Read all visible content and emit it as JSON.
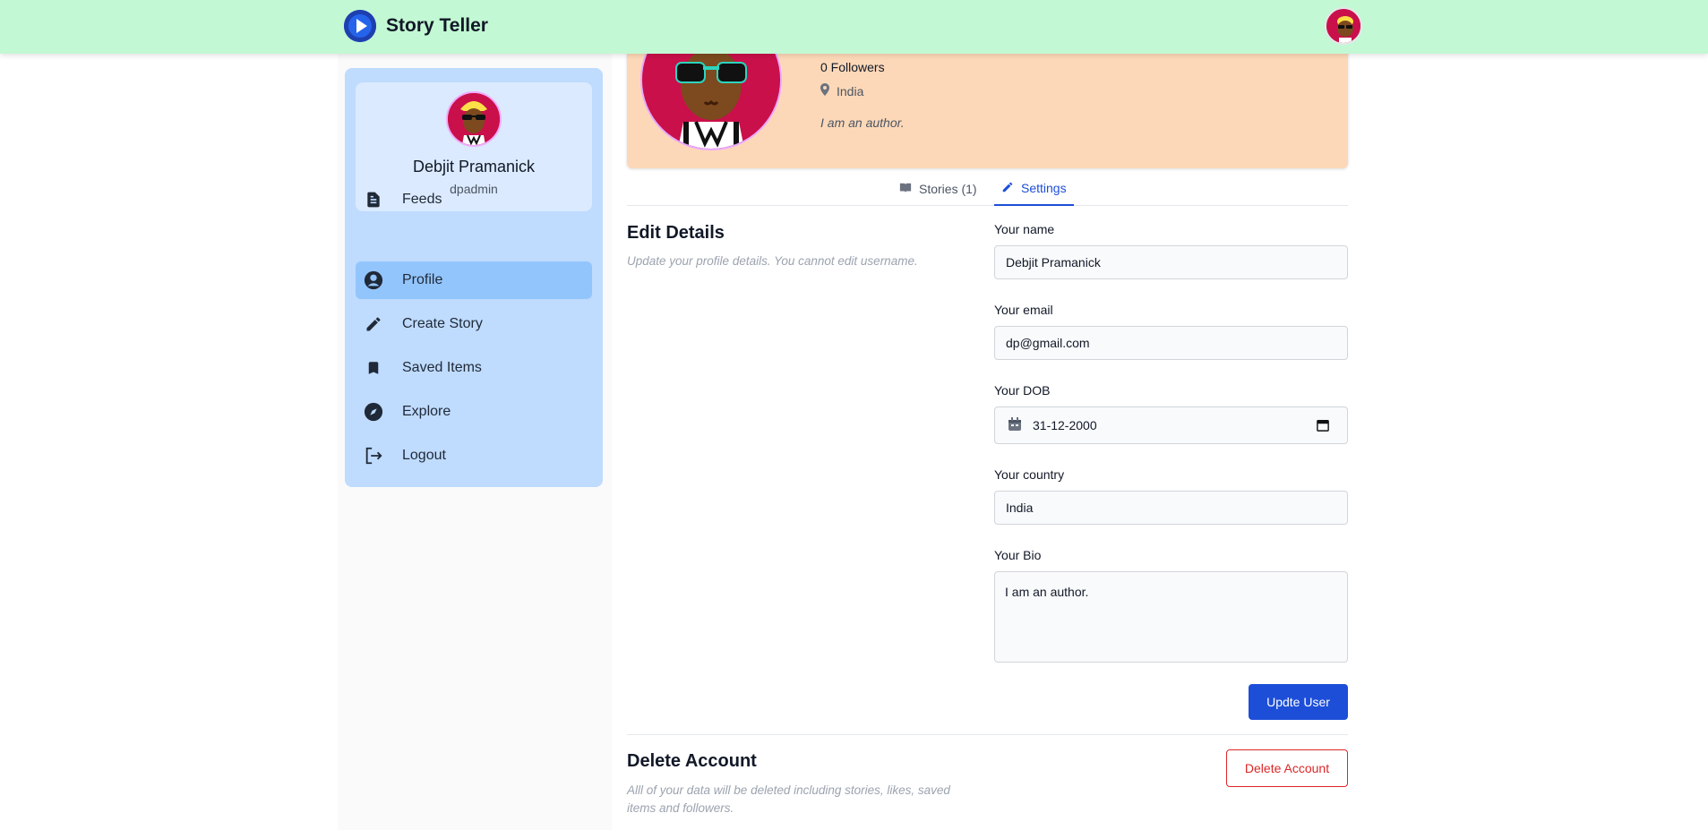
{
  "app": {
    "title": "Story Teller"
  },
  "sidebar": {
    "user": {
      "name": "Debjit Pramanick",
      "username": "dpadmin"
    },
    "items": [
      {
        "label": "Feeds",
        "icon": "feed-icon"
      },
      {
        "label": "Profile",
        "icon": "account-circle-icon"
      },
      {
        "label": "Create Story",
        "icon": "pencil-icon"
      },
      {
        "label": "Saved Items",
        "icon": "bookmark-icon"
      },
      {
        "label": "Explore",
        "icon": "compass-icon"
      },
      {
        "label": "Logout",
        "icon": "logout-icon"
      }
    ],
    "active": "Profile"
  },
  "profile": {
    "followers": "0 Followers",
    "location": "India",
    "bio": "I am an author."
  },
  "tabs": [
    {
      "label": "Stories (1)",
      "icon": "book-icon"
    },
    {
      "label": "Settings",
      "icon": "pencil-icon",
      "active": true
    }
  ],
  "edit": {
    "title": "Edit Details",
    "description": "Update your profile details. You cannot edit username.",
    "fields": {
      "name": {
        "label": "Your name",
        "value": "Debjit Pramanick"
      },
      "email": {
        "label": "Your email",
        "value": "dp@gmail.com"
      },
      "dob": {
        "label": "Your DOB",
        "value": "31-12-2000"
      },
      "country": {
        "label": "Your country",
        "value": "India"
      },
      "bio": {
        "label": "Your Bio",
        "value": "I am an author."
      }
    },
    "submit_label": "Updte User"
  },
  "delete": {
    "title": "Delete Account",
    "description_line1": "Alll of your data will be deleted including stories, likes, saved",
    "description_line2": "items and followers.",
    "button_label": "Delete Account"
  },
  "colors": {
    "header": "#c2f8d3",
    "sidebar": "#bfdbfe",
    "hero": "#fdd8b8",
    "primary": "#1d4ed8",
    "danger": "#dc2626"
  }
}
